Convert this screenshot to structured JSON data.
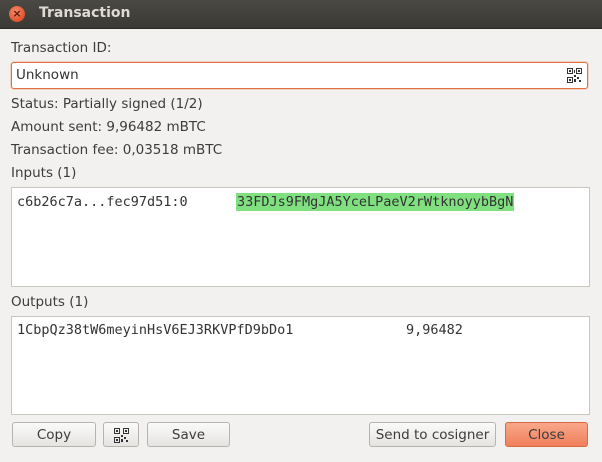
{
  "window": {
    "title": "Transaction",
    "close_glyph": "×"
  },
  "txid": {
    "label": "Transaction ID:",
    "value": "Unknown",
    "qr_icon": "qr-code-icon"
  },
  "status": "Status: Partially signed (1/2)",
  "amount_sent": "Amount sent: 9,96482 mBTC",
  "fee": "Transaction fee: 0,03518 mBTC",
  "inputs": {
    "label": "Inputs (1)",
    "rows": [
      {
        "prevout": "c6b26c7a...fec97d51:0",
        "address": "33FDJs9FMgJA5YceLPaeV2rWtknoyybBgN",
        "highlight": "#80e080"
      }
    ]
  },
  "outputs": {
    "label": "Outputs (1)",
    "rows": [
      {
        "address": "1CbpQz38tW6meyinHsV6EJ3RKVPfD9bDo1",
        "amount": "9,96482"
      }
    ]
  },
  "buttons": {
    "copy": "Copy",
    "qr_icon": "qr-code-icon",
    "save": "Save",
    "send_to_cosigner": "Send to cosigner",
    "close": "Close"
  },
  "colors": {
    "accent": "#f07f5b",
    "focus_border": "#e0703f",
    "address_highlight": "#80e080"
  }
}
